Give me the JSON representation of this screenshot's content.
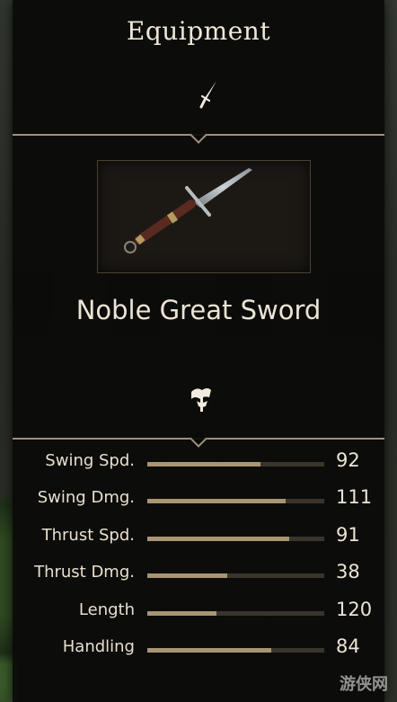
{
  "header": {
    "title": "Equipment"
  },
  "item": {
    "name": "Noble Great Sword",
    "category_icon": "dagger-icon",
    "image": "noble-great-sword"
  },
  "stats_section": {
    "icon": "scroll-icon"
  },
  "stats": [
    {
      "label": "Swing Spd.",
      "value": "92",
      "fill": 0.64
    },
    {
      "label": "Swing Dmg.",
      "value": "111",
      "fill": 0.78
    },
    {
      "label": "Thrust Spd.",
      "value": "91",
      "fill": 0.8
    },
    {
      "label": "Thrust Dmg.",
      "value": "38",
      "fill": 0.45
    },
    {
      "label": "Length",
      "value": "120",
      "fill": 0.39
    },
    {
      "label": "Handling",
      "value": "84",
      "fill": 0.7
    }
  ],
  "watermark": "游侠网",
  "colors": {
    "accent": "#a2907a",
    "bar_fill": "#a99573",
    "bar_track": "#3a352c",
    "text": "#ece4d5"
  }
}
